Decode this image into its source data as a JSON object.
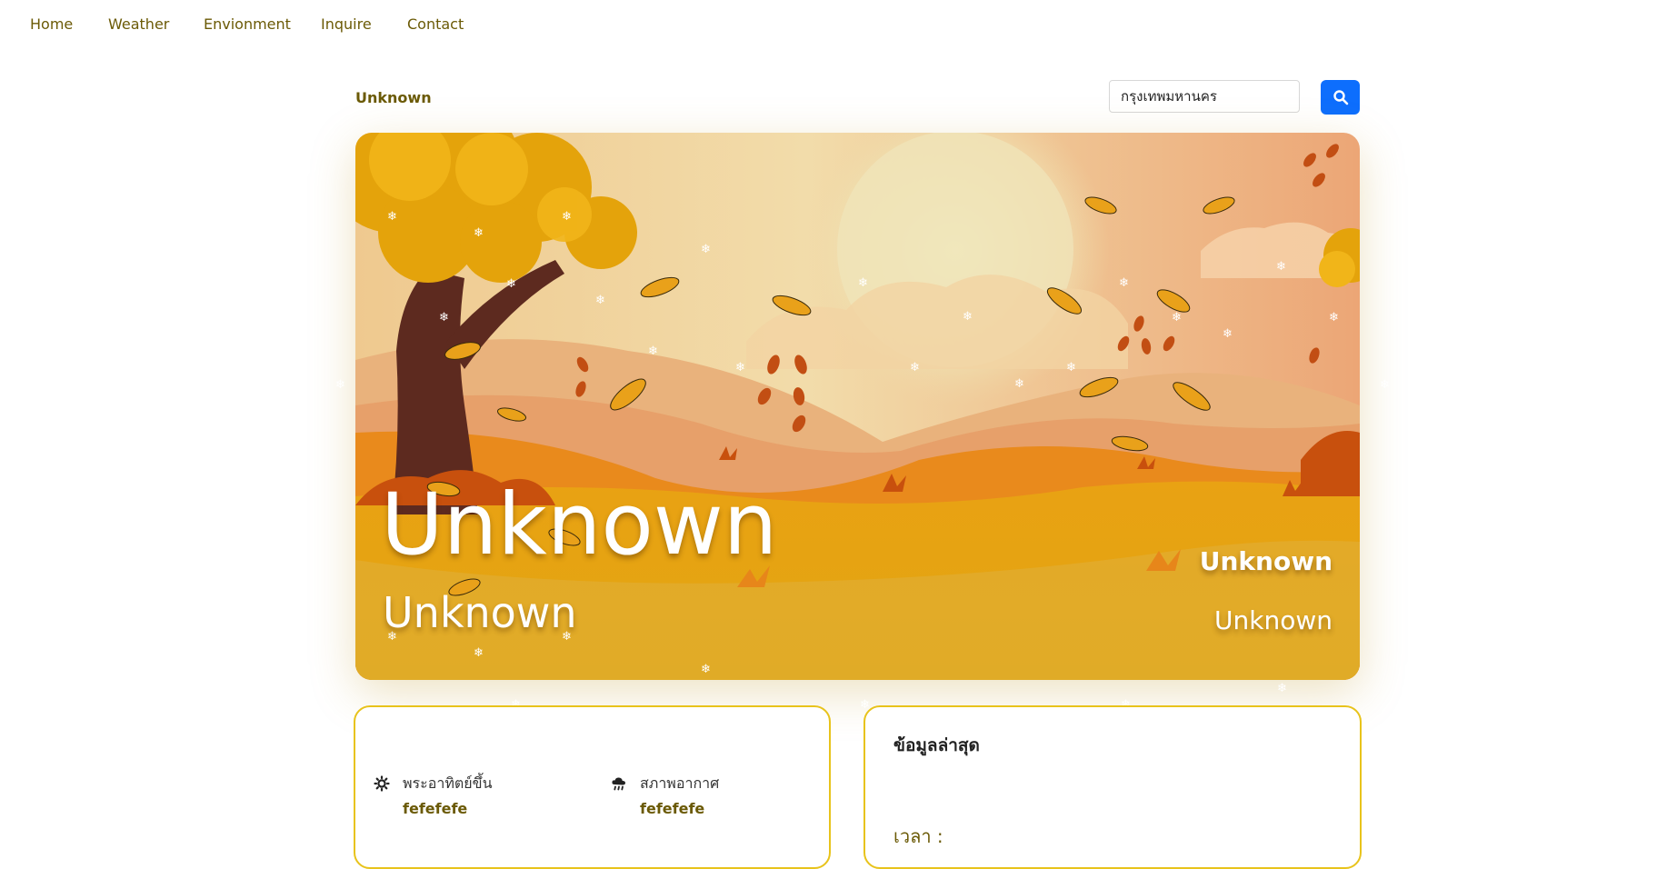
{
  "nav": {
    "items": [
      "Home",
      "Weather",
      "Envionment",
      "Inquire",
      "Contact"
    ]
  },
  "location": {
    "label": "Unknown"
  },
  "search": {
    "value": "กรุงเทพมหานคร",
    "button_icon": "search-icon",
    "button_color": "#0d6efd"
  },
  "hero": {
    "main": "Unknown",
    "sub": "Unknown",
    "right_top": "Unknown",
    "right_bottom": "Unknown",
    "theme": "autumn"
  },
  "details": {
    "sunrise_label": "พระอาทิตย์ขึ้น",
    "sunrise_value": "fefefefe",
    "sunrise_icon": "sun-icon",
    "condition_label": "สภาพอากาศ",
    "condition_value": "fefefefe",
    "condition_icon": "cloud-rain-icon"
  },
  "latest": {
    "title": "ข้อมูลล่าสุด",
    "time_label": "เวลา :"
  },
  "colors": {
    "accent": "#e8c31b",
    "text_olive": "#6b5a06"
  }
}
